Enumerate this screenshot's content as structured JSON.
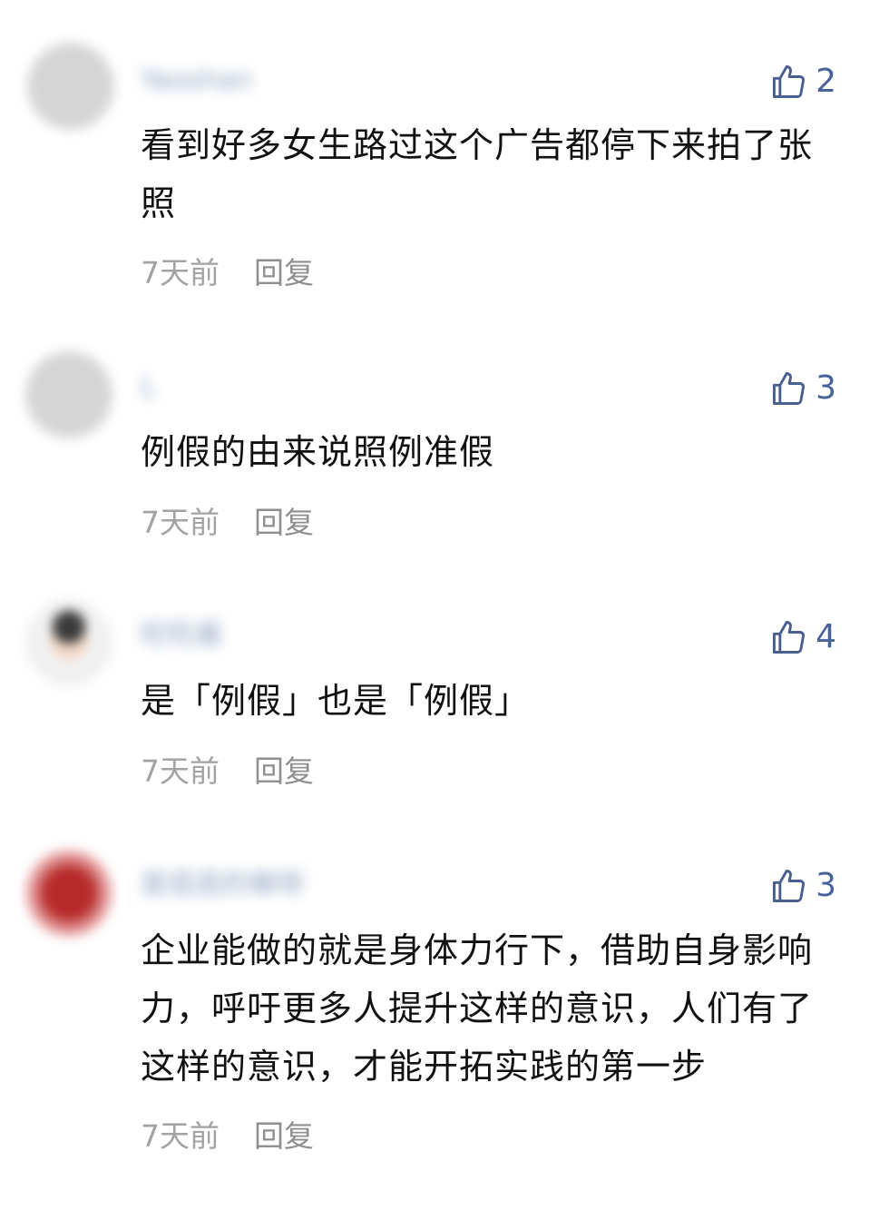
{
  "comments": [
    {
      "username": "Yaoshan",
      "likes": "2",
      "text": "看到好多女生路过这个广告都停下来拍了张照",
      "time": "7天前",
      "reply_label": "回复",
      "avatar_icon": "avatar-blurred"
    },
    {
      "username": "L",
      "likes": "3",
      "text": "例假的由来说照例准假",
      "time": "7天前",
      "reply_label": "回复",
      "avatar_icon": "avatar-blurred"
    },
    {
      "username": "旺旺酱",
      "likes": "4",
      "text": "是「例假」也是「例假」",
      "time": "7天前",
      "reply_label": "回复",
      "avatar_icon": "avatar-person-blurred"
    },
    {
      "username": "是逛逛的嘛呀",
      "likes": "3",
      "text": "企业能做的就是身体力行下，借助自身影响力，呼吁更多人提升这样的意识，人们有了这样的意识，才能开拓实践的第一步",
      "time": "7天前",
      "reply_label": "回复",
      "avatar_icon": "avatar-red-blurred"
    }
  ],
  "colors": {
    "like_icon": "#4a5f8f",
    "username": "#8fa3c4",
    "meta": "#a3a3a3"
  }
}
